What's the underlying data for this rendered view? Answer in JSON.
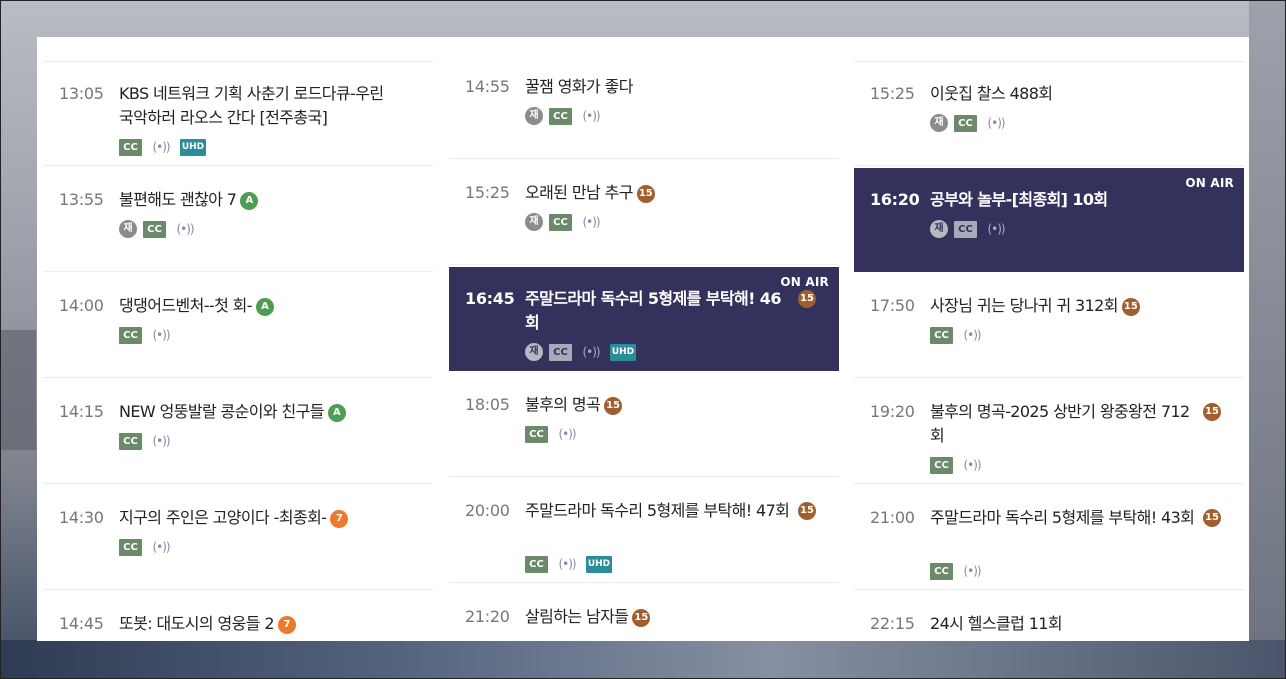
{
  "columns": [
    {
      "items": [
        {
          "time": "13:05",
          "title": "KBS 네트워크 기획 사춘기 로드다큐-우린 국악하러 라오스 간다 [전주총국]",
          "grade": "",
          "badges": [
            "CC",
            "audio",
            "UHD"
          ]
        },
        {
          "time": "13:55",
          "title": "불편해도 괜찮아 7",
          "grade": "A",
          "badges": [
            "재",
            "CC",
            "audio"
          ]
        },
        {
          "time": "14:00",
          "title": "댕댕어드벤처--첫 회-",
          "grade": "A",
          "badges": [
            "CC",
            "audio"
          ]
        },
        {
          "time": "14:15",
          "title": "NEW 엉뚱발랄 콩순이와 친구들",
          "grade": "A",
          "badges": [
            "CC",
            "audio"
          ]
        },
        {
          "time": "14:30",
          "title": "지구의 주인은 고양이다 -최종회-",
          "grade": "7",
          "badges": [
            "CC",
            "audio"
          ]
        },
        {
          "time": "14:45",
          "title": "또봇: 대도시의 영웅들 2",
          "grade": "7",
          "badges": []
        }
      ]
    },
    {
      "items": [
        {
          "time": "14:55",
          "title": "꿀잼 영화가 좋다",
          "grade": "",
          "badges": [
            "재",
            "CC",
            "audio"
          ]
        },
        {
          "time": "15:25",
          "title": "오래된 만남 추구",
          "grade": "15",
          "badges": [
            "재",
            "CC",
            "audio"
          ]
        },
        {
          "time": "16:45",
          "title": "주말드라마 독수리 5형제를 부탁해! 46회",
          "grade": "15",
          "badges": [
            "재",
            "CC",
            "audio",
            "UHD"
          ],
          "on_air": "ON AIR"
        },
        {
          "time": "18:05",
          "title": "불후의 명곡",
          "grade": "15",
          "badges": [
            "CC",
            "audio"
          ]
        },
        {
          "time": "20:00",
          "title": "주말드라마 독수리 5형제를 부탁해! 47회",
          "grade": "15",
          "badges": [
            "CC",
            "audio",
            "UHD"
          ]
        },
        {
          "time": "21:20",
          "title": "살림하는 남자들",
          "grade": "15",
          "badges": []
        }
      ]
    },
    {
      "items": [
        {
          "time": "15:25",
          "title": "이웃집 찰스 488회",
          "grade": "",
          "badges": [
            "재",
            "CC",
            "audio"
          ]
        },
        {
          "time": "16:20",
          "title": "공부와 놀부-[최종회] 10회",
          "grade": "",
          "badges": [
            "재",
            "CC",
            "audio"
          ],
          "on_air": "ON AIR"
        },
        {
          "time": "17:50",
          "title": "사장님 귀는 당나귀 귀 312회",
          "grade": "15",
          "badges": [
            "CC",
            "audio"
          ]
        },
        {
          "time": "19:20",
          "title": "불후의 명곡-2025 상반기 왕중왕전 712회",
          "grade": "15",
          "badges": [
            "CC",
            "audio"
          ]
        },
        {
          "time": "21:00",
          "title": "주말드라마 독수리 5형제를 부탁해! 43회",
          "grade": "15",
          "badges": [
            "CC",
            "audio"
          ]
        },
        {
          "time": "22:15",
          "title": "24시 헬스클럽 11회",
          "grade": "",
          "badges": []
        }
      ]
    }
  ],
  "badge_labels": {
    "re": "재",
    "cc": "CC",
    "audio": "(•))",
    "uhd": "UHD"
  },
  "colors": {
    "on_air_bg": "#34325c",
    "grade_all": "#4d9e52",
    "grade_7": "#ea7a2c",
    "grade_15": "#a15e2e",
    "cc": "#6b8a6a",
    "uhd": "#2a8d9a"
  }
}
